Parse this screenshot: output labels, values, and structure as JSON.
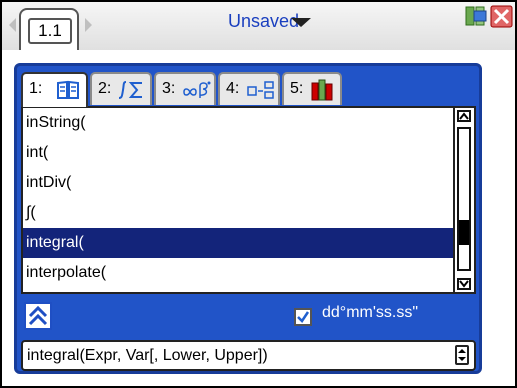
{
  "topbar": {
    "page_tab": "1.1",
    "document_title": "Unsaved"
  },
  "catalog": {
    "tabs": [
      {
        "number": "1:",
        "icon": "book-icon"
      },
      {
        "number": "2:",
        "icon": "integral-sum-icon"
      },
      {
        "number": "3:",
        "icon": "infinity-beta-icon"
      },
      {
        "number": "4:",
        "icon": "units-icon"
      },
      {
        "number": "5:",
        "icon": "library-icon"
      }
    ],
    "items": [
      {
        "label": "inString("
      },
      {
        "label": "int("
      },
      {
        "label": "intDiv("
      },
      {
        "label": "∫("
      },
      {
        "label": "integral("
      },
      {
        "label": "interpolate("
      }
    ],
    "selected_index": 4,
    "scroll_position": 0.55,
    "checkbox_label": "dd°mm'ss.ss\"",
    "checkbox_checked": true,
    "syntax_help": "integral(Expr, Var[, Lower, Upper])"
  },
  "colors": {
    "panel_blue": "#2154c8",
    "selection_navy": "#13247a",
    "title_blue": "#1a3fbf"
  }
}
